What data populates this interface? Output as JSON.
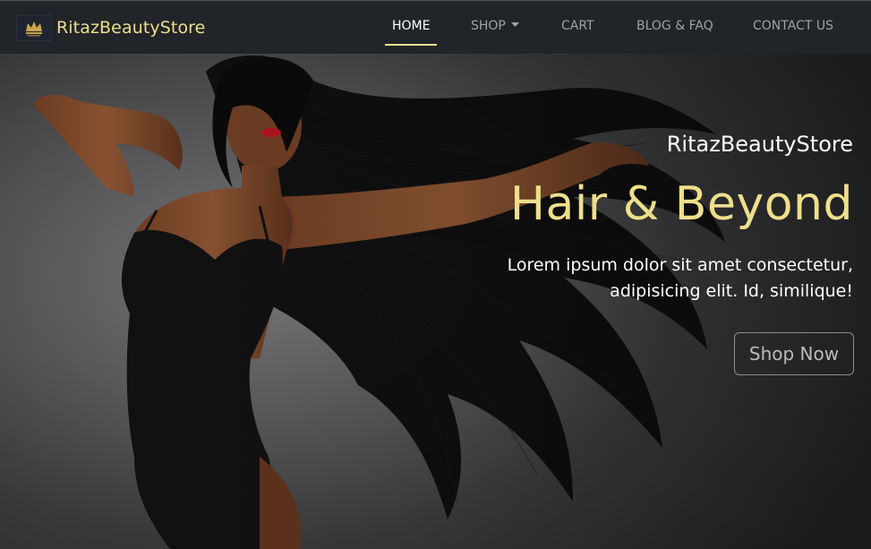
{
  "brand": {
    "name": "RitazBeautyStore",
    "logo_icon": "crown-logo-icon"
  },
  "nav": {
    "home": "HOME",
    "shop": "SHOP",
    "cart": "CART",
    "blog": "BLOG & FAQ",
    "contact": "CONTACT US",
    "active": "home"
  },
  "hero": {
    "subtitle": "RitazBeautyStore",
    "title": "Hair & Beyond",
    "text": "Lorem ipsum dolor sit amet consectetur, adipisicing elit. Id, similique!",
    "cta": "Shop Now"
  },
  "colors": {
    "accent": "#eedf8b",
    "navbar": "#212428",
    "nav_text": "#9ea2a6"
  }
}
